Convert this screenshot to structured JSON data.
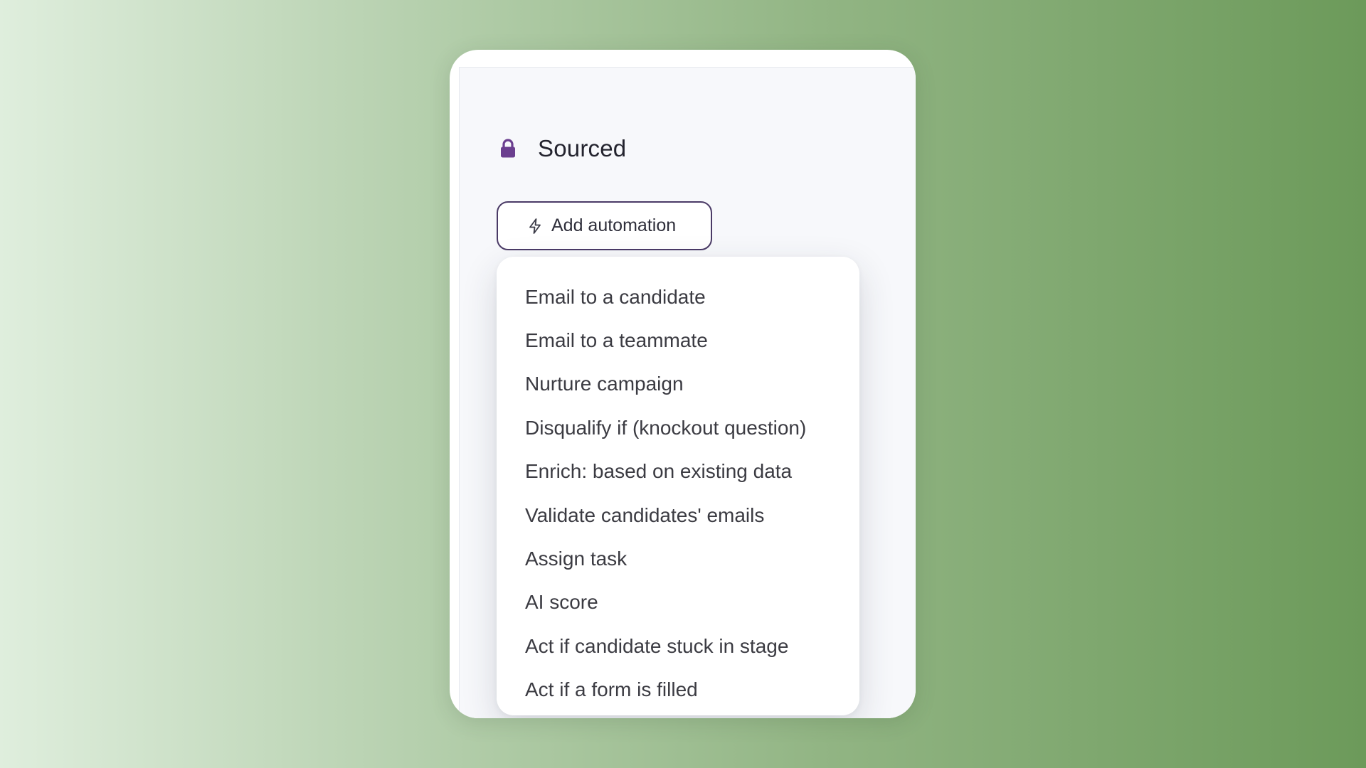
{
  "stage": {
    "title": "Sourced",
    "icon": "lock-icon",
    "icon_color": "#6b3f8f"
  },
  "add_automation": {
    "label": "Add automation",
    "icon": "bolt-icon",
    "border_color": "#4a3a66"
  },
  "menu": {
    "items": [
      {
        "label": "Email to a candidate"
      },
      {
        "label": "Email to a teammate"
      },
      {
        "label": "Nurture campaign"
      },
      {
        "label": "Disqualify if (knockout question)"
      },
      {
        "label": "Enrich: based on existing data"
      },
      {
        "label": "Validate candidates' emails"
      },
      {
        "label": "Assign task"
      },
      {
        "label": "AI score"
      },
      {
        "label": "Act if candidate stuck in stage"
      },
      {
        "label": "Act if a form is filled"
      }
    ]
  }
}
